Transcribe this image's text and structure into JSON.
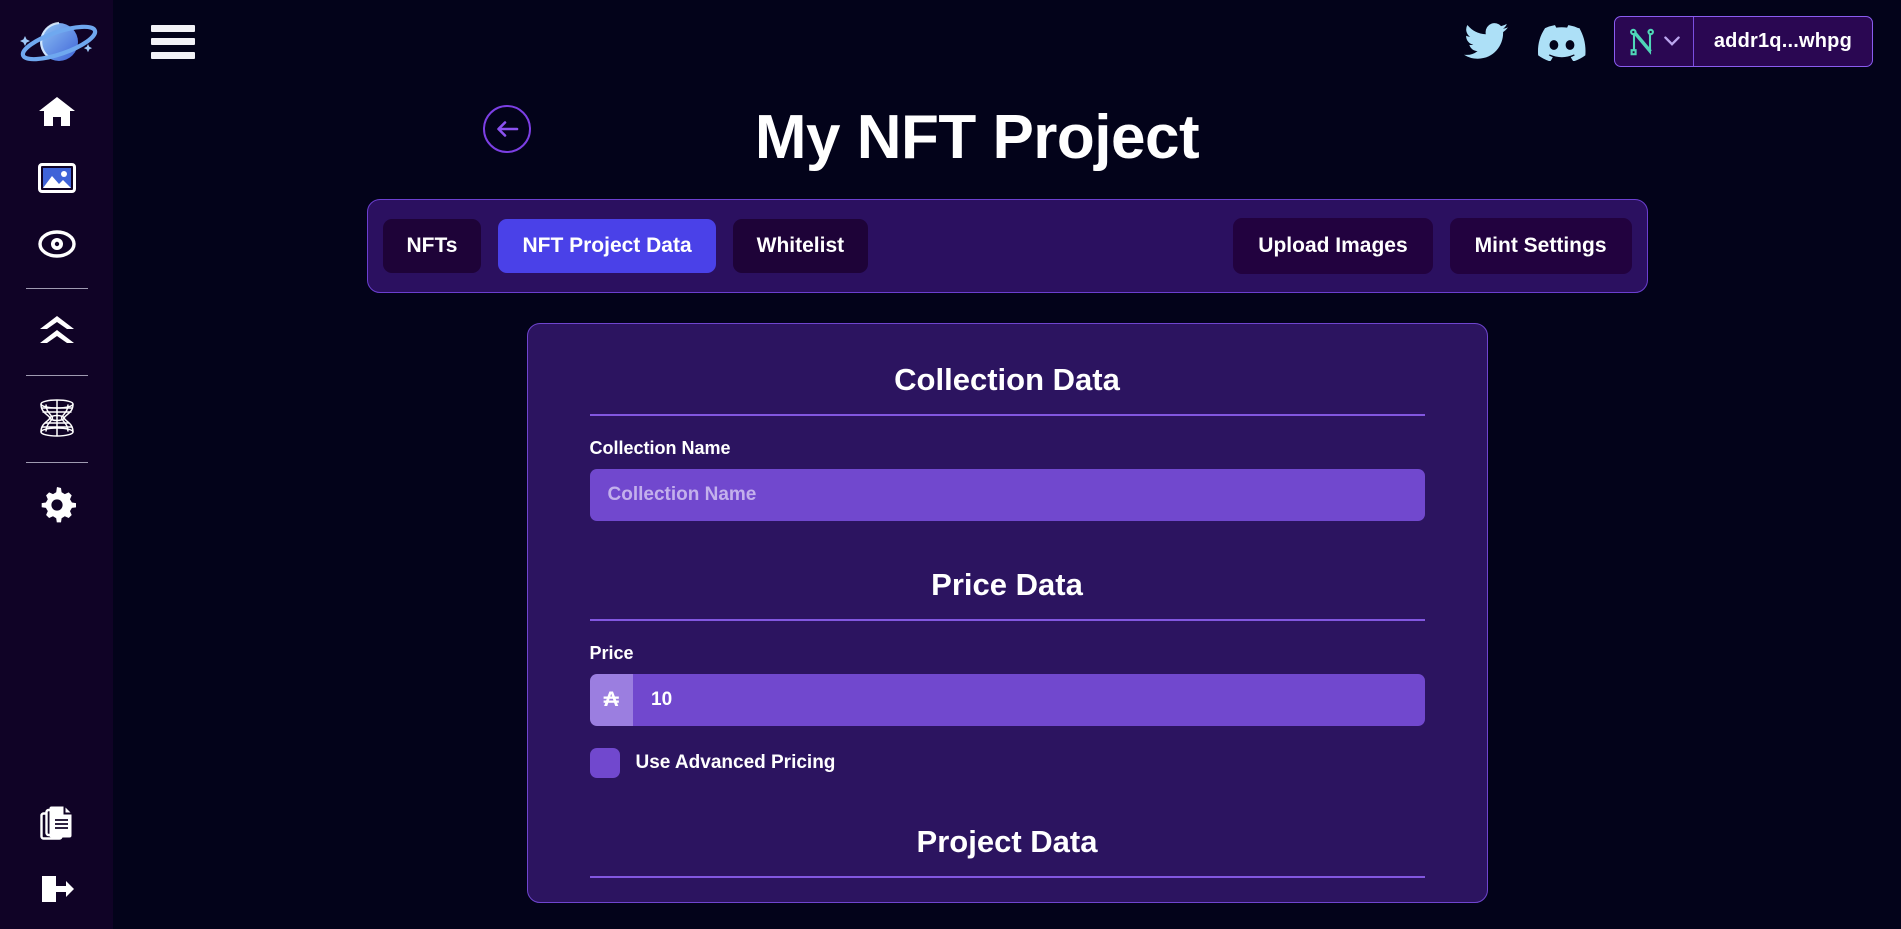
{
  "app": {
    "logo_icon": "saturn-planet-logo",
    "background_color": "#03031a",
    "sidebar_color": "#100326",
    "accent_color": "#7148ce",
    "active_tab_color": "#4a41e8"
  },
  "sidebar": {
    "items": [
      {
        "icon": "home-icon",
        "name": "home"
      },
      {
        "icon": "image-icon",
        "name": "gallery"
      },
      {
        "icon": "eye-target-icon",
        "name": "explore"
      },
      {
        "icon": "double-chevron-up-icon",
        "name": "upgrade"
      },
      {
        "icon": "wormhole-icon",
        "name": "wormhole"
      },
      {
        "icon": "gear-icon",
        "name": "settings"
      }
    ],
    "bottom_items": [
      {
        "icon": "documents-icon",
        "name": "documents"
      },
      {
        "icon": "logout-icon",
        "name": "logout"
      }
    ]
  },
  "topbar": {
    "menu_icon": "hamburger-menu-icon",
    "twitter_icon": "twitter-icon",
    "discord_icon": "discord-icon",
    "wallet": {
      "provider_icon": "nami-wallet-icon",
      "chevron_icon": "chevron-down-icon",
      "address": "addr1q...whpg"
    }
  },
  "page": {
    "back_icon": "arrow-left-circle-icon",
    "title": "My NFT Project"
  },
  "tabs": [
    {
      "label": "NFTs",
      "active": false
    },
    {
      "label": "NFT Project Data",
      "active": true
    },
    {
      "label": "Whitelist",
      "active": false
    }
  ],
  "actions": [
    {
      "label": "Upload Images"
    },
    {
      "label": "Mint Settings"
    }
  ],
  "form": {
    "collection_section": {
      "title": "Collection Data",
      "collection_name": {
        "label": "Collection Name",
        "placeholder": "Collection Name",
        "value": ""
      }
    },
    "price_section": {
      "title": "Price Data",
      "price": {
        "label": "Price",
        "prefix": "₳",
        "value": "10"
      },
      "advanced_pricing": {
        "label": "Use Advanced Pricing",
        "checked": false
      }
    },
    "project_section": {
      "title": "Project Data"
    }
  }
}
